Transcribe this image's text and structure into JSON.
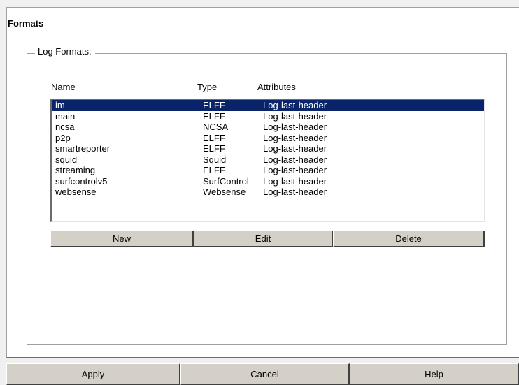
{
  "section": {
    "title": "Formats"
  },
  "group": {
    "legend": "Log Formats:"
  },
  "columns": {
    "name": "Name",
    "type": "Type",
    "attributes": "Attributes"
  },
  "rows": [
    {
      "name": "im",
      "type": "ELFF",
      "attributes": "Log-last-header",
      "selected": true
    },
    {
      "name": "main",
      "type": "ELFF",
      "attributes": "Log-last-header"
    },
    {
      "name": "ncsa",
      "type": "NCSA",
      "attributes": "Log-last-header"
    },
    {
      "name": "p2p",
      "type": "ELFF",
      "attributes": "Log-last-header"
    },
    {
      "name": "smartreporter",
      "type": "ELFF",
      "attributes": "Log-last-header"
    },
    {
      "name": "squid",
      "type": "Squid",
      "attributes": "Log-last-header"
    },
    {
      "name": "streaming",
      "type": "ELFF",
      "attributes": "Log-last-header"
    },
    {
      "name": "surfcontrolv5",
      "type": "SurfControl",
      "attributes": "Log-last-header"
    },
    {
      "name": "websense",
      "type": "Websense",
      "attributes": "Log-last-header"
    }
  ],
  "list_buttons": {
    "new": "New",
    "edit": "Edit",
    "delete": "Delete"
  },
  "dialog_buttons": {
    "apply": "Apply",
    "cancel": "Cancel",
    "help": "Help"
  },
  "colors": {
    "selection": "#0a246a",
    "button_face": "#d4d0c8",
    "window_bg": "#f0f0f0"
  }
}
